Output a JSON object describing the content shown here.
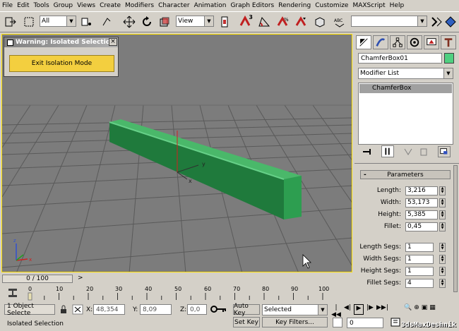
{
  "menu": [
    "File",
    "Edit",
    "Tools",
    "Group",
    "Views",
    "Create",
    "Modifiers",
    "Character",
    "Animation",
    "Graph Editors",
    "Rendering",
    "Customize",
    "MAXScript",
    "Help"
  ],
  "toolbar": {
    "selection_filter": "All",
    "view_dropdown": "View",
    "angle_snap_label": "3"
  },
  "warning": {
    "title": "Warning: Isolated Selection",
    "exit_button": "Exit Isolation Mode",
    "close": "×"
  },
  "command_panel": {
    "object_name": "ChamferBox01",
    "object_color": "#4fd080",
    "modifier_list": "Modifier List",
    "stack_item": "ChamferBox",
    "rollout_toggle": "-",
    "rollout_title": "Parameters",
    "params": [
      {
        "label": "Length:",
        "value": "3,216"
      },
      {
        "label": "Width:",
        "value": "53,173"
      },
      {
        "label": "Height:",
        "value": "5,385"
      },
      {
        "label": "Fillet:",
        "value": "0,45"
      },
      {
        "label": "Length Segs:",
        "value": "1"
      },
      {
        "label": "Width Segs:",
        "value": "1"
      },
      {
        "label": "Height Segs:",
        "value": "1"
      },
      {
        "label": "Fillet Segs:",
        "value": "4"
      }
    ]
  },
  "timeline": {
    "slider": "0 / 100",
    "ticks": [
      "0",
      "10",
      "20",
      "30",
      "40",
      "50",
      "60",
      "70",
      "80",
      "90",
      "100"
    ]
  },
  "status": {
    "selected_count": "1 Object Selecte",
    "x_label": "X:",
    "x_value": "48,354",
    "y_label": "Y:",
    "y_value": "8,09",
    "z_label": "Z:",
    "z_value": "0,0",
    "auto_key": "Auto Key",
    "set_key": "Set Key",
    "selected_dropdown": "Selected",
    "key_filters": "Key Filters...",
    "frame": "0",
    "message": "Isolated Selection"
  },
  "watermark": "3dsMaxDeshnik",
  "colors": {
    "box": "#2f9e55",
    "viewport": "#7c7c7c",
    "exit_button": "#f3cf3f",
    "active_border": "#ffe000"
  }
}
